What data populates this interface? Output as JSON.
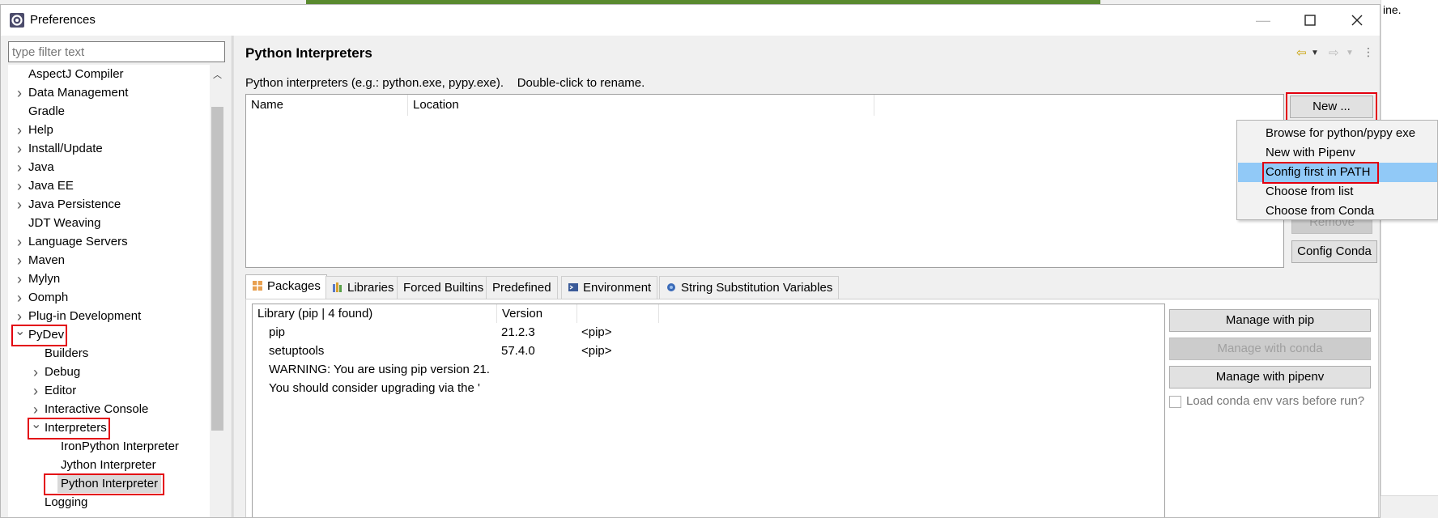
{
  "window": {
    "title": "Preferences"
  },
  "background_text": "ine.",
  "filter": {
    "placeholder": "type filter text"
  },
  "tree": {
    "items": [
      {
        "label": "AspectJ Compiler"
      },
      {
        "label": "Data Management"
      },
      {
        "label": "Gradle"
      },
      {
        "label": "Help"
      },
      {
        "label": "Install/Update"
      },
      {
        "label": "Java"
      },
      {
        "label": "Java EE"
      },
      {
        "label": "Java Persistence"
      },
      {
        "label": "JDT Weaving"
      },
      {
        "label": "Language Servers"
      },
      {
        "label": "Maven"
      },
      {
        "label": "Mylyn"
      },
      {
        "label": "Oomph"
      },
      {
        "label": "Plug-in Development"
      },
      {
        "label": "PyDev"
      },
      {
        "label": "Builders"
      },
      {
        "label": "Debug"
      },
      {
        "label": "Editor"
      },
      {
        "label": "Interactive Console"
      },
      {
        "label": "Interpreters"
      },
      {
        "label": "IronPython Interpreter"
      },
      {
        "label": "Jython Interpreter"
      },
      {
        "label": "Python Interpreter"
      },
      {
        "label": "Logging"
      }
    ]
  },
  "page": {
    "title": "Python Interpreters",
    "description": "Python interpreters (e.g.: python.exe, pypy.exe).    Double-click to rename.",
    "table_columns": [
      "Name",
      "Location"
    ],
    "buttons": {
      "new": "New ...",
      "remove": "Remove",
      "config_conda": "Config Conda"
    }
  },
  "new_menu": {
    "items": [
      {
        "label": "Browse for python/pypy exe"
      },
      {
        "label": "New with Pipenv"
      },
      {
        "label": "Config first in PATH"
      },
      {
        "label": "Choose from list"
      },
      {
        "label": "Choose from Conda"
      }
    ]
  },
  "tabs": [
    {
      "label": "Packages",
      "icon": "packages-icon"
    },
    {
      "label": "Libraries",
      "icon": "libraries-icon"
    },
    {
      "label": "Forced Builtins"
    },
    {
      "label": "Predefined"
    },
    {
      "label": "Environment",
      "icon": "environment-icon"
    },
    {
      "label": "String Substitution Variables",
      "icon": "variables-icon"
    }
  ],
  "packages": {
    "columns": [
      "Library (pip | 4 found)",
      "Version"
    ],
    "rows": [
      [
        "pip",
        "21.2.3",
        "<pip>"
      ],
      [
        "setuptools",
        "57.4.0",
        "<pip>"
      ],
      [
        "WARNING: You are using pip version 21.",
        "",
        ""
      ],
      [
        "You should consider upgrading via the '",
        "",
        ""
      ]
    ],
    "buttons": {
      "pip": "Manage with pip",
      "conda": "Manage with conda",
      "pipenv": "Manage with pipenv"
    },
    "checkbox_label": "Load conda env vars before run?"
  },
  "colors": {
    "highlight_box": "#e3000f",
    "menu_selection": "#91c9f7"
  }
}
